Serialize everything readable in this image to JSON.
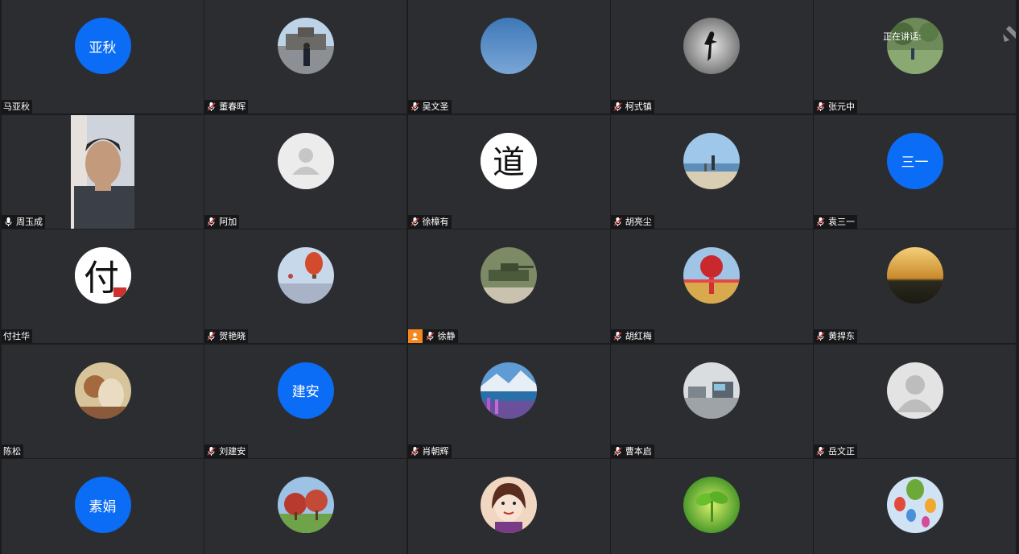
{
  "speaking_label": "正在讲话:",
  "participants": [
    {
      "name": "马亚秋",
      "avatar_text": "亚秋",
      "avatar_kind": "text",
      "muted_icon": false
    },
    {
      "name": "董春晖",
      "avatar_kind": "photo-castle",
      "muted_icon": true
    },
    {
      "name": "吴文圣",
      "avatar_kind": "photo-sky",
      "muted_icon": true
    },
    {
      "name": "柯式镇",
      "avatar_kind": "photo-silhouette",
      "muted_icon": true
    },
    {
      "name": "张元中",
      "avatar_kind": "photo-garden",
      "muted_icon": true
    },
    {
      "name": "周玉成",
      "avatar_kind": "live-video",
      "muted_icon": false,
      "mic_active": true
    },
    {
      "name": "阿加",
      "avatar_kind": "default-person-light",
      "muted_icon": true
    },
    {
      "name": "徐樟有",
      "avatar_kind": "calligraphy-dao",
      "avatar_text": "道",
      "muted_icon": true
    },
    {
      "name": "胡亮尘",
      "avatar_kind": "photo-beach",
      "muted_icon": true
    },
    {
      "name": "袁三一",
      "avatar_text": "三一",
      "avatar_kind": "text",
      "muted_icon": true
    },
    {
      "name": "付社华",
      "avatar_kind": "calligraphy-fu",
      "avatar_text": "付",
      "muted_icon": false
    },
    {
      "name": "贺艳晓",
      "avatar_kind": "photo-balloon",
      "muted_icon": true
    },
    {
      "name": "徐静",
      "avatar_kind": "photo-tank",
      "muted_icon": true,
      "host": true
    },
    {
      "name": "胡红梅",
      "avatar_kind": "photo-flowers",
      "muted_icon": true
    },
    {
      "name": "黄捍东",
      "avatar_kind": "photo-sunset",
      "muted_icon": true
    },
    {
      "name": "陈松",
      "avatar_kind": "photo-art",
      "muted_icon": false
    },
    {
      "name": "刘建安",
      "avatar_text": "建安",
      "avatar_kind": "text",
      "muted_icon": true
    },
    {
      "name": "肖朝辉",
      "avatar_kind": "photo-lake",
      "muted_icon": true
    },
    {
      "name": "曹本启",
      "avatar_kind": "photo-lab",
      "muted_icon": true
    },
    {
      "name": "岳文正",
      "avatar_kind": "default-person-gray",
      "muted_icon": true
    },
    {
      "name": "",
      "avatar_text": "素娟",
      "avatar_kind": "text"
    },
    {
      "name": "",
      "avatar_kind": "photo-trees"
    },
    {
      "name": "",
      "avatar_kind": "cartoon-woman"
    },
    {
      "name": "",
      "avatar_kind": "photo-sprout"
    },
    {
      "name": "",
      "avatar_kind": "photo-balloons-multi"
    }
  ],
  "icons": {
    "muted_mic": "muted-mic-icon",
    "mic": "mic-icon",
    "host": "host-person-icon",
    "corner": "pin-icon"
  },
  "colors": {
    "tile_bg": "#2c2d30",
    "text_avatar_bg": "#0b6cf5",
    "host_badge": "#f5871f",
    "mute_red": "#e23b32"
  }
}
